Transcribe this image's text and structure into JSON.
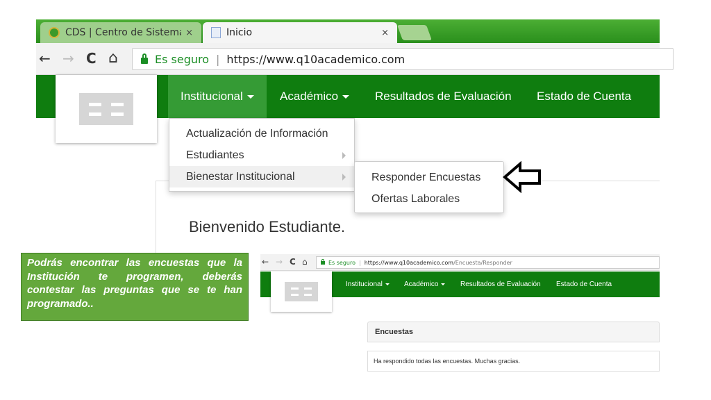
{
  "browser": {
    "tabs": [
      {
        "title": "CDS | Centro de Sistemas",
        "close": "×",
        "favicon": "cds-logo-icon"
      },
      {
        "title": "Inicio",
        "close": "×",
        "favicon": "document-icon"
      }
    ],
    "nav_icons": {
      "back": "←",
      "forward": "→",
      "reload": "C",
      "home": "⌂"
    },
    "secure_label": "Es seguro",
    "separator": "|",
    "url": "https://www.q10academico.com"
  },
  "navbar": {
    "items": [
      {
        "label": "Institucional",
        "has_caret": true,
        "active": true
      },
      {
        "label": "Académico",
        "has_caret": true
      },
      {
        "label": "Resultados de Evaluación"
      },
      {
        "label": "Estado de Cuenta"
      }
    ]
  },
  "dropdown": {
    "items": [
      {
        "label": "Actualización de Información"
      },
      {
        "label": "Estudiantes",
        "has_submenu": true
      },
      {
        "label": "Bienestar Institucional",
        "has_submenu": true,
        "hover": true
      }
    ]
  },
  "submenu": {
    "items": [
      {
        "label": "Responder Encuestas"
      },
      {
        "label": "Ofertas Laborales"
      }
    ]
  },
  "welcome": {
    "text": "Bienvenido Estudiante."
  },
  "note": {
    "text": " Podrás encontrar las encuestas que la Institución te programen, deberás contestar las preguntas que se te han programado.."
  },
  "inset": {
    "nav_icons": {
      "back": "←",
      "forward": "→",
      "reload": "C",
      "home": "⌂"
    },
    "secure_label": "Es seguro",
    "separator": "|",
    "url_host": "https://www.q10academico.com",
    "url_path": "/Encuesta/Responder",
    "navbar_items": [
      {
        "label": "Institucional"
      },
      {
        "label": "Académico"
      },
      {
        "label": "Resultados de Evaluación"
      },
      {
        "label": "Estado de Cuenta"
      }
    ],
    "panel_title": "Encuestas",
    "panel_message": "Ha respondido todas las encuestas. Muchas gracias."
  },
  "colors": {
    "brand_green": "#0f7d0f",
    "tab_strip_green": "#2a8f1c",
    "note_green": "#64a83c",
    "secure_green": "#1b8e25"
  }
}
